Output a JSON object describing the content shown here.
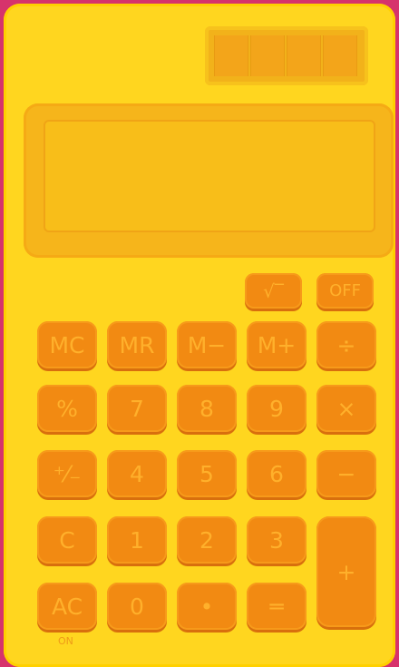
{
  "calculator": {
    "keys": {
      "sqrt": "√‾",
      "off": "OFF",
      "mc": "MC",
      "mr": "MR",
      "m_minus": "M−",
      "m_plus": "M+",
      "divide": "÷",
      "percent": "%",
      "seven": "7",
      "eight": "8",
      "nine": "9",
      "multiply": "×",
      "plus_minus": "⁺⁄₋",
      "four": "4",
      "five": "5",
      "six": "6",
      "minus": "−",
      "clear": "C",
      "one": "1",
      "two": "2",
      "three": "3",
      "plus": "+",
      "all_clear": "AC",
      "zero": "0",
      "decimal": "•",
      "equals": "═"
    },
    "on_label": "ON"
  }
}
